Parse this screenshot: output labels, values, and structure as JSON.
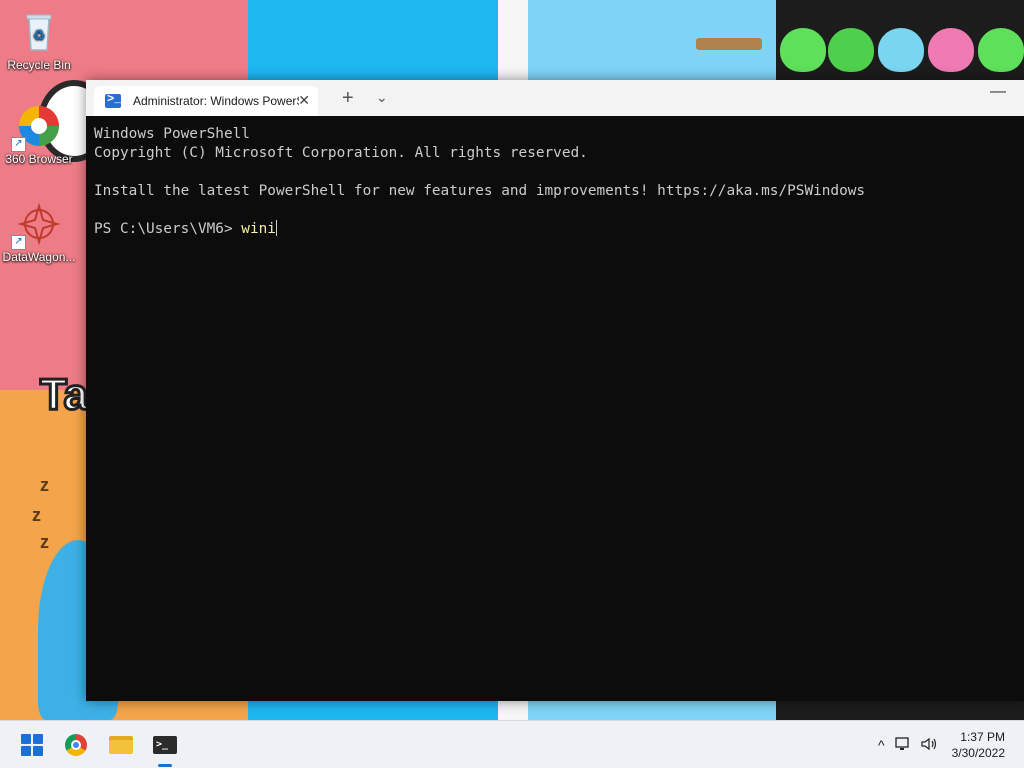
{
  "desktop": {
    "icons": [
      {
        "label": "Recycle Bin"
      },
      {
        "label": "360 Browser"
      },
      {
        "label": "DataWagon..."
      }
    ]
  },
  "terminal": {
    "tab_title": "Administrator: Windows PowerS",
    "tab_close": "✕",
    "new_tab": "+",
    "dropdown": "⌄",
    "minimize": "—",
    "lines": {
      "l1": "Windows PowerShell",
      "l2": "Copyright (C) Microsoft Corporation. All rights reserved.",
      "l3": "Install the latest PowerShell for new features and improvements! https://aka.ms/PSWindows",
      "prompt": "PS C:\\Users\\VM6> ",
      "command": "wini"
    }
  },
  "taskbar": {
    "apps": [
      {
        "icon": "windows-start-icon"
      },
      {
        "icon": "chrome-icon"
      },
      {
        "icon": "file-explorer-icon"
      },
      {
        "icon": "terminal-icon",
        "active": true
      }
    ],
    "tray": {
      "chevron": "^",
      "time": "1:37 PM",
      "date": "3/30/2022"
    }
  },
  "colors": {
    "terminal_bg": "#0c0c0c",
    "terminal_text": "#cccccc",
    "command_text": "#f9f1a5",
    "accent": "#1a6fd8"
  }
}
